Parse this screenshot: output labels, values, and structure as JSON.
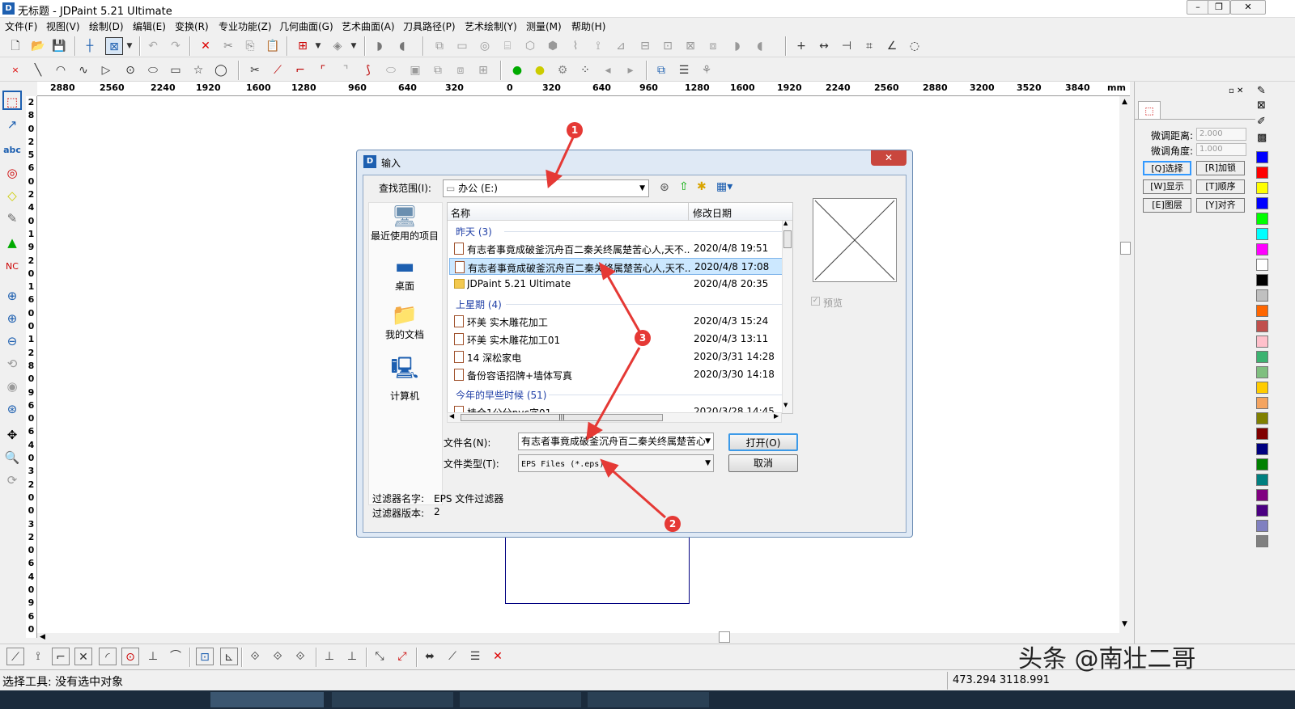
{
  "window": {
    "title": "无标题 - JDPaint 5.21 Ultimate",
    "app_icon": "D"
  },
  "menu": [
    "文件(F)",
    "视图(V)",
    "绘制(D)",
    "编辑(E)",
    "变换(R)",
    "专业功能(Z)",
    "几何曲面(G)",
    "艺术曲面(A)",
    "刀具路径(P)",
    "艺术绘制(Y)",
    "测量(M)",
    "帮助(H)"
  ],
  "ruler": {
    "ticks": [
      "2880",
      "2560",
      "2240",
      "1920",
      "1600",
      "1280",
      "960",
      "640",
      "320",
      "0",
      "320",
      "640",
      "960",
      "1280",
      "1600",
      "1920",
      "2240",
      "2560",
      "2880",
      "3200",
      "3520",
      "3840"
    ],
    "unit": "mm"
  },
  "vruler": {
    "digits": [
      "2",
      "8",
      "0",
      "2",
      "5",
      "6",
      "0",
      "2",
      "4",
      "0",
      "1",
      "9",
      "2",
      "0",
      "1",
      "6",
      "0",
      "0",
      "1",
      "2",
      "8",
      "0",
      "9",
      "6",
      "0",
      "6",
      "4",
      "0",
      "3",
      "2",
      "0",
      "0",
      "3",
      "2",
      "0",
      "6",
      "4",
      "0",
      "9",
      "6",
      "0"
    ]
  },
  "right_panel": {
    "distance_label": "微调距离:",
    "distance_value": "2.000",
    "angle_label": "微调角度:",
    "angle_value": "1.000",
    "buttons": [
      "[Q]选择",
      "[R]加锁",
      "[W]显示",
      "[T]顺序",
      "[E]图层",
      "[Y]对齐"
    ]
  },
  "palette": {
    "colors": [
      "#0000ff",
      "#ff0000",
      "#ffff00",
      "#0000ff",
      "#00ff00",
      "#00ffff",
      "#ff00ff",
      "#ffffff",
      "#000000",
      "#c0c0c0",
      "#ff6600",
      "#c0504d",
      "#ffc0cb",
      "#3cb371",
      "#7fbf7f",
      "#ffcc00",
      "#f4a460",
      "#808000",
      "#800000",
      "#000080",
      "#008000",
      "#008080",
      "#800080",
      "#4b0082",
      "#8080c0",
      "#808080"
    ]
  },
  "dialog": {
    "title": "输入",
    "lookin_label": "查找范围(I):",
    "lookin_value": "办公 (E:)",
    "places": [
      "最近使用的项目",
      "桌面",
      "我的文档",
      "计算机"
    ],
    "columns": {
      "name": "名称",
      "date": "修改日期"
    },
    "groups": [
      {
        "label": "昨天 (3)",
        "files": [
          {
            "name": "有志者事竟成破釜沉舟百二秦关终属楚苦心人,天不...",
            "date": "2020/4/8 19:51",
            "type": "doc"
          },
          {
            "name": "有志者事竟成破釜沉舟百二秦关终属楚苦心人,天不...",
            "date": "2020/4/8 17:08",
            "type": "doc"
          },
          {
            "name": "JDPaint 5.21 Ultimate",
            "date": "2020/4/8 20:35",
            "type": "folder"
          }
        ]
      },
      {
        "label": "上星期 (4)",
        "files": [
          {
            "name": "环美  实木雕花加工",
            "date": "2020/4/3 15:24",
            "type": "doc"
          },
          {
            "name": "环美  实木雕花加工01",
            "date": "2020/4/3 13:11",
            "type": "doc"
          },
          {
            "name": "14 深松家电",
            "date": "2020/3/31 14:28",
            "type": "doc"
          },
          {
            "name": "备份容语招牌+墙体写真",
            "date": "2020/3/30 14:18",
            "type": "doc"
          }
        ]
      },
      {
        "label": "今年的早些时候 (51)",
        "files": [
          {
            "name": "桂全1公分pvc字01",
            "date": "2020/3/28 14:45",
            "type": "doc"
          }
        ]
      }
    ],
    "preview_label": "预览",
    "filename_label": "文件名(N):",
    "filename_value": "有志者事竟成破釜沉舟百二秦关终属楚苦心",
    "filetype_label": "文件类型(T):",
    "filetype_value": "EPS Files (*.eps)",
    "open_button": "打开(O)",
    "cancel_button": "取消",
    "filter_name_label": "过滤器名字:",
    "filter_name_value": "EPS 文件过滤器",
    "filter_version_label": "过滤器版本:",
    "filter_version_value": "2"
  },
  "badges": [
    "1",
    "2",
    "3"
  ],
  "status": {
    "text": "选择工具: 没有选中对象",
    "coords": "473.294  3118.991"
  },
  "watermark": "头条 @南壮二哥",
  "colors": {
    "accent": "#e53935",
    "selection": "#cce8ff",
    "canvas_rect": "#000080"
  }
}
